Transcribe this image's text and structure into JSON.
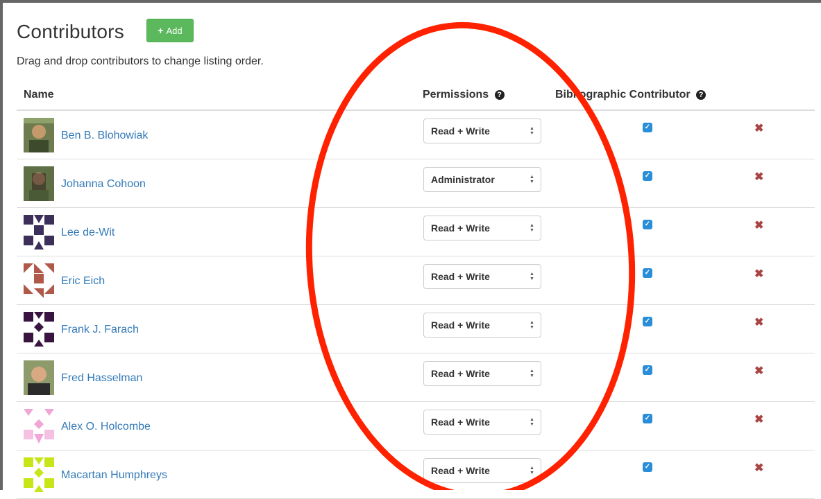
{
  "page": {
    "title": "Contributors",
    "add_label": "Add",
    "instructions": "Drag and drop contributors to change listing order."
  },
  "columns": {
    "name": "Name",
    "permissions": "Permissions",
    "bibliographic": "Bibliographic Contributor"
  },
  "icons": {
    "add": "plus-icon",
    "help": "question-circle-icon",
    "select": "up-down-arrows-icon",
    "checkbox": "check-icon",
    "remove": "x-icon"
  },
  "colors": {
    "add_button": "#5cb85c",
    "link": "#337ab7",
    "checkbox": "#2a8dd8",
    "remove": "#a94442",
    "annotation": "#ff2200"
  },
  "contributors": [
    {
      "name": "Ben B. Blohowiak",
      "permission": "Read + Write",
      "bibliographic": true,
      "avatar": "photo"
    },
    {
      "name": "Johanna Cohoon",
      "permission": "Administrator",
      "bibliographic": true,
      "avatar": "photo"
    },
    {
      "name": "Lee de-Wit",
      "permission": "Read + Write",
      "bibliographic": true,
      "avatar": "identicon"
    },
    {
      "name": "Eric Eich",
      "permission": "Read + Write",
      "bibliographic": true,
      "avatar": "identicon"
    },
    {
      "name": "Frank J. Farach",
      "permission": "Read + Write",
      "bibliographic": true,
      "avatar": "identicon"
    },
    {
      "name": "Fred Hasselman",
      "permission": "Read + Write",
      "bibliographic": true,
      "avatar": "photo"
    },
    {
      "name": "Alex O. Holcombe",
      "permission": "Read + Write",
      "bibliographic": true,
      "avatar": "identicon"
    },
    {
      "name": "Macartan Humphreys",
      "permission": "Read + Write",
      "bibliographic": true,
      "avatar": "identicon"
    }
  ]
}
